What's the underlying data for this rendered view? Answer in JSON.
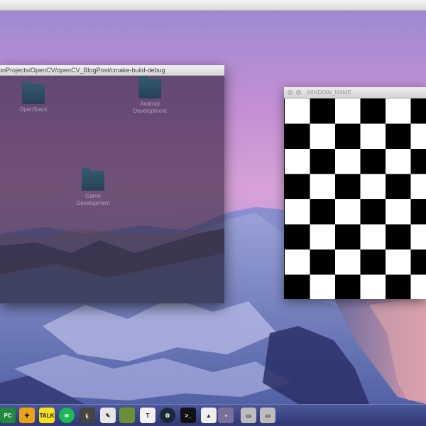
{
  "desktop_window": {
    "path_title": "onProjects/OpenCV/openCV_BlogPost/cmake-build-debug",
    "folders": [
      {
        "label": "OpenStack"
      },
      {
        "label": "Android Development"
      },
      {
        "label": "Game Development"
      }
    ]
  },
  "cv_window": {
    "title": "WINDOW_NAME",
    "board_colors": {
      "dark": "#000000",
      "light": "#ffffff"
    }
  },
  "dock": {
    "items": [
      {
        "name": "pycharm-icon",
        "glyph": "PC",
        "bg": "#1f8a3c"
      },
      {
        "name": "grid-app-icon",
        "glyph": "✚",
        "bg": "#e8a317"
      },
      {
        "name": "kakaotalk-icon",
        "glyph": "TALK",
        "bg": "#f7e01b"
      },
      {
        "name": "spotify-icon",
        "glyph": "≋",
        "bg": "#1db954"
      },
      {
        "name": "penguin-app-icon",
        "glyph": "🐧",
        "bg": "#444444"
      },
      {
        "name": "pencil-app-icon",
        "glyph": "✎",
        "bg": "#e6e6e6"
      },
      {
        "name": "code-editor-icon",
        "glyph": "</>",
        "bg": "#6a8e3a"
      },
      {
        "name": "typora-icon",
        "glyph": "T",
        "bg": "#f2f2f2"
      },
      {
        "name": "steam-icon",
        "glyph": "⚙",
        "bg": "#1b2838"
      },
      {
        "name": "terminal-icon",
        "glyph": "&gt;_",
        "bg": "#111111"
      },
      {
        "name": "preview-icon",
        "glyph": "▲",
        "bg": "#eeeeee"
      },
      {
        "name": "small-app-icon",
        "glyph": "▪",
        "bg": "#7a6f9a"
      },
      {
        "name": "drive-icon-1",
        "glyph": "▭",
        "bg": "#bcbcbc"
      },
      {
        "name": "drive-icon-2",
        "glyph": "▭",
        "bg": "#bcbcbc"
      }
    ]
  }
}
